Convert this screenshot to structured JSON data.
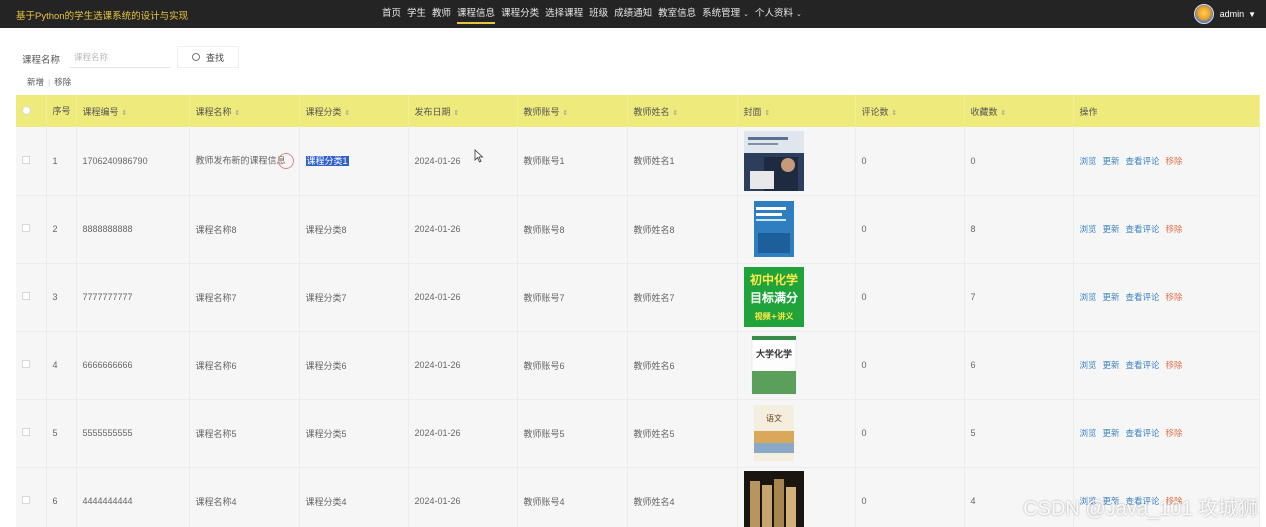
{
  "header": {
    "title": "基于Python的学生选课系统的设计与实现",
    "nav": [
      {
        "label": "首页"
      },
      {
        "label": "学生"
      },
      {
        "label": "教师"
      },
      {
        "label": "课程信息",
        "active": true
      },
      {
        "label": "课程分类"
      },
      {
        "label": "选择课程"
      },
      {
        "label": "班级"
      },
      {
        "label": "成绩通知"
      },
      {
        "label": "教室信息"
      },
      {
        "label": "系统管理",
        "dropdown": true
      },
      {
        "label": "个人资料",
        "dropdown": true
      }
    ],
    "username": "admin"
  },
  "search": {
    "label": "课程名称",
    "placeholder": "课程名称",
    "button": "查找"
  },
  "actions": {
    "add": "新增",
    "remove": "移除"
  },
  "table": {
    "columns": [
      "序号",
      "课程编号",
      "课程名称",
      "课程分类",
      "发布日期",
      "教师账号",
      "教师姓名",
      "封面",
      "评论数",
      "收藏数",
      "操作"
    ],
    "row_ops": [
      "浏览",
      "更新",
      "查看评论",
      "移除"
    ],
    "rows": [
      {
        "idx": "1",
        "code": "1706240986790",
        "name": "教师发布新的课程信息",
        "category": "课程分类1",
        "date": "2024-01-26",
        "teacher_account": "教师账号1",
        "teacher_name": "教师姓名1",
        "cover": "cover-photo-person",
        "comments": "0",
        "favorites": "0"
      },
      {
        "idx": "2",
        "code": "8888888888",
        "name": "课程名称8",
        "category": "课程分类8",
        "date": "2024-01-26",
        "teacher_account": "教师账号8",
        "teacher_name": "教师姓名8",
        "cover": "cover-blue-book",
        "comments": "0",
        "favorites": "8"
      },
      {
        "idx": "3",
        "code": "7777777777",
        "name": "课程名称7",
        "category": "课程分类7",
        "date": "2024-01-26",
        "teacher_account": "教师账号7",
        "teacher_name": "教师姓名7",
        "cover": "cover-green-chemistry",
        "comments": "0",
        "favorites": "7"
      },
      {
        "idx": "4",
        "code": "6666666666",
        "name": "课程名称6",
        "category": "课程分类6",
        "date": "2024-01-26",
        "teacher_account": "教师账号6",
        "teacher_name": "教师姓名6",
        "cover": "cover-university-chemistry",
        "comments": "0",
        "favorites": "6"
      },
      {
        "idx": "5",
        "code": "5555555555",
        "name": "课程名称5",
        "category": "课程分类5",
        "date": "2024-01-26",
        "teacher_account": "教师账号5",
        "teacher_name": "教师姓名5",
        "cover": "cover-chinese-book",
        "comments": "0",
        "favorites": "5"
      },
      {
        "idx": "6",
        "code": "4444444444",
        "name": "课程名称4",
        "category": "课程分类4",
        "date": "2024-01-26",
        "teacher_account": "教师账号4",
        "teacher_name": "教师姓名4",
        "cover": "cover-dark-books",
        "comments": "0",
        "favorites": "4"
      }
    ]
  },
  "cover_texts": {
    "green_line1": "初中化学",
    "green_line2": "目标满分",
    "green_line3": "视频+讲义",
    "university_chem": "大学化学",
    "chinese": "语文"
  },
  "watermark": "CSDN @Java_101 攻城狮",
  "colors": {
    "topbar_bg": "#242424",
    "accent": "#e6c53f",
    "table_header_bg": "#eeea7c",
    "link_blue": "#3b82c4",
    "link_red": "#e8704a",
    "selection": "#3060c8"
  }
}
